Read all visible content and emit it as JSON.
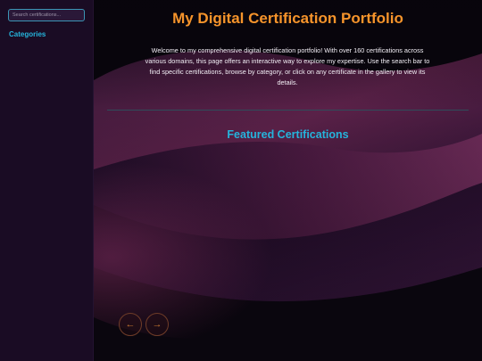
{
  "sidebar": {
    "search": {
      "placeholder": "Search certifications...",
      "value": ""
    },
    "categories_heading": "Categories"
  },
  "main": {
    "title": "My Digital Certification Portfolio",
    "intro": "Welcome to my comprehensive digital certification portfolio! With over 160 certifications across various domains, this page offers an interactive way to explore my expertise. Use the search bar to find specific certifications, browse by category, or click on any certificate in the gallery to view its details.",
    "featured_heading": "Featured Certifications"
  },
  "carousel": {
    "prev_icon": "arrow-left-icon",
    "prev_glyph": "←",
    "next_icon": "arrow-right-icon",
    "next_glyph": "→"
  },
  "colors": {
    "accent_orange": "#f6942b",
    "accent_cyan": "#25b4dc",
    "sidebar_bg": "#1a0c24",
    "main_bg": "#07050b"
  }
}
